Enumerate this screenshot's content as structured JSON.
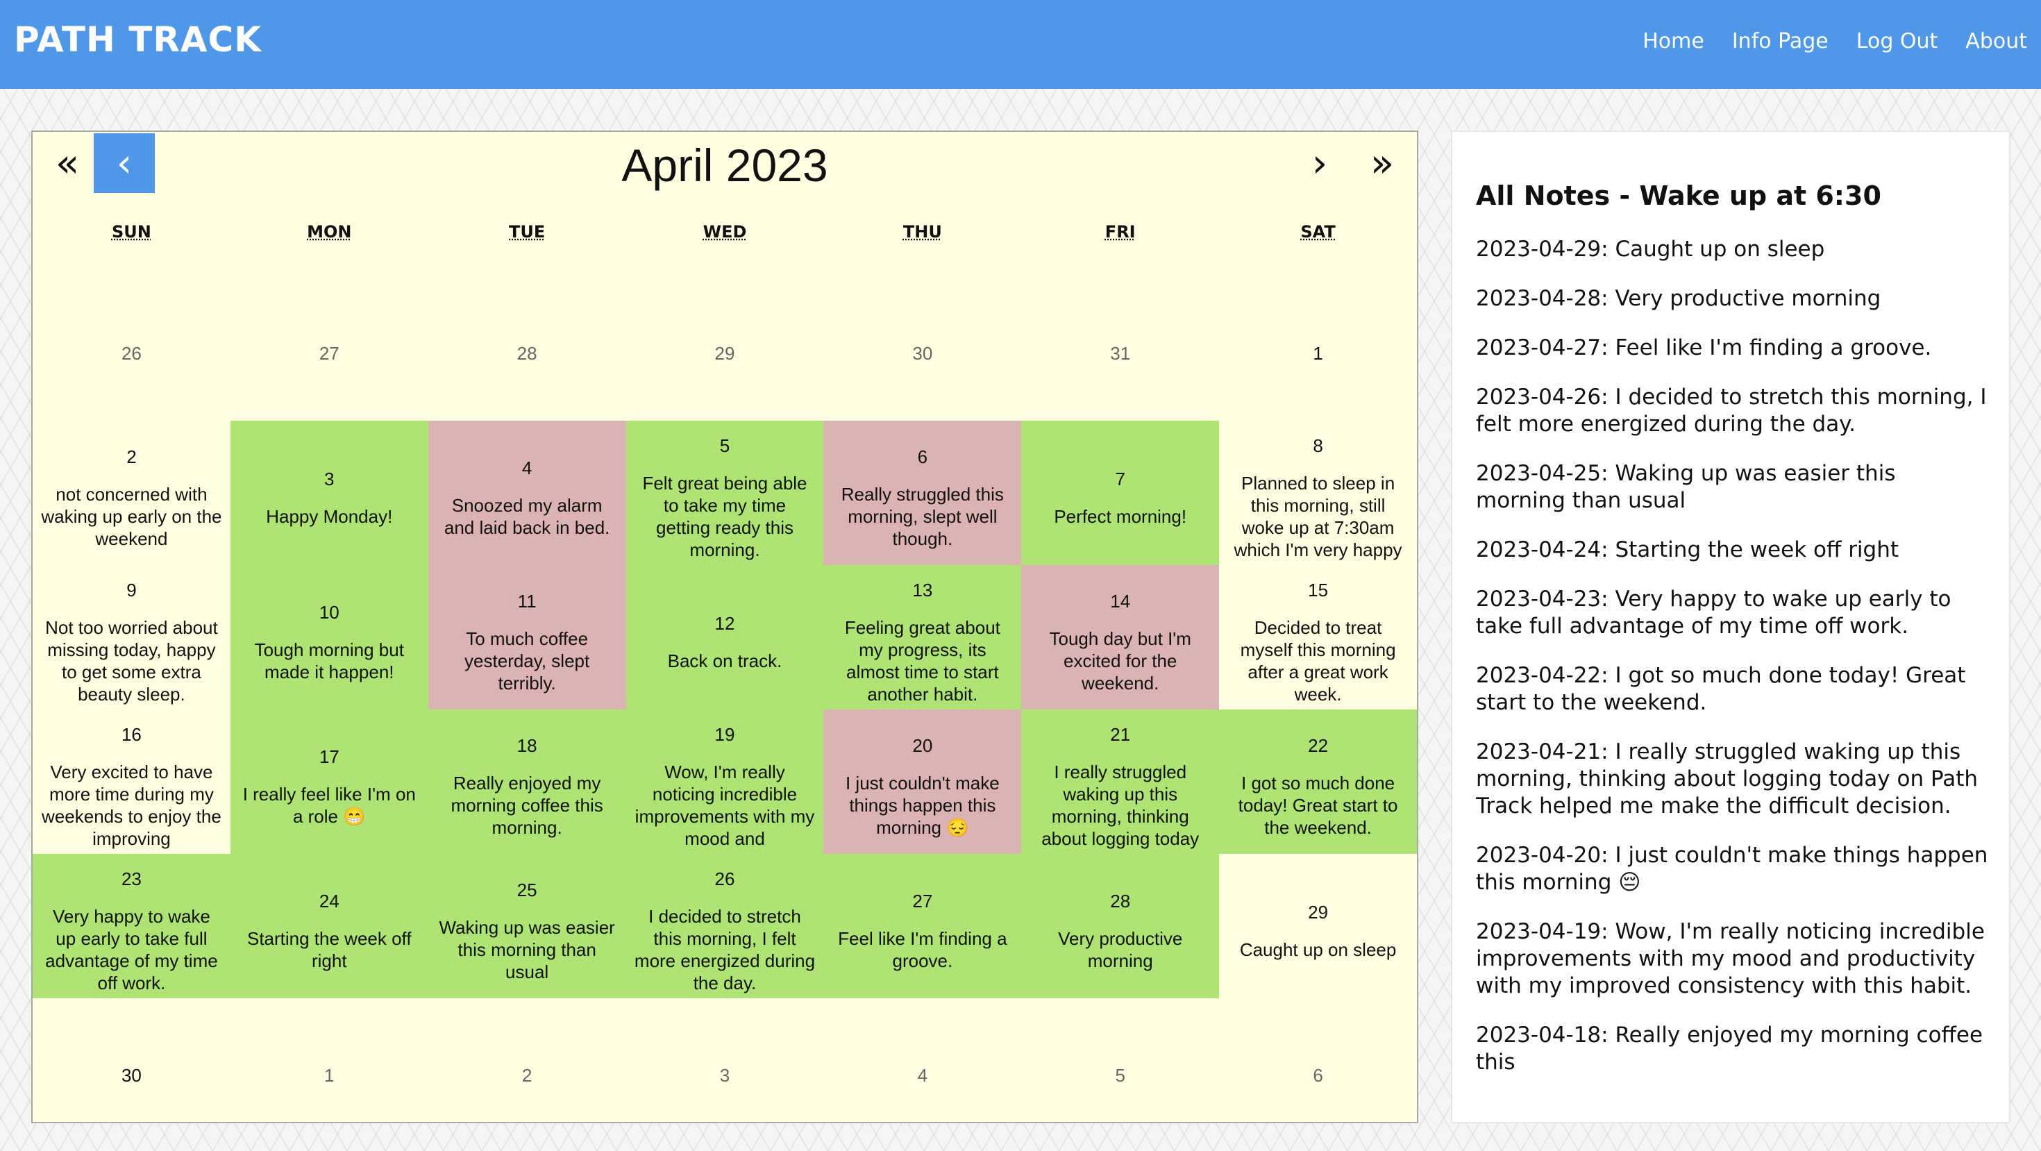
{
  "app": {
    "brand": "PATH TRACK",
    "nav": [
      "Home",
      "Info Page",
      "Log Out",
      "About"
    ]
  },
  "calendar": {
    "title": "April 2023",
    "controls": {
      "prev_year": "«",
      "prev_month": "‹",
      "next_month": "›",
      "next_year": "»"
    },
    "weekdays": [
      "SUN",
      "MON",
      "TUE",
      "WED",
      "THU",
      "FRI",
      "SAT"
    ],
    "colors": {
      "good": "#aee474",
      "bad": "#dbb3b3",
      "background": "#ffffe2",
      "accent": "#4e97e9"
    },
    "weeks": [
      [
        {
          "day": "26",
          "note": "",
          "status": "other"
        },
        {
          "day": "27",
          "note": "",
          "status": "other"
        },
        {
          "day": "28",
          "note": "",
          "status": "other"
        },
        {
          "day": "29",
          "note": "",
          "status": "other"
        },
        {
          "day": "30",
          "note": "",
          "status": "other"
        },
        {
          "day": "31",
          "note": "",
          "status": "other"
        },
        {
          "day": "1",
          "note": "",
          "status": "empty"
        }
      ],
      [
        {
          "day": "2",
          "note": "not concerned with waking up early on the weekend",
          "status": "none"
        },
        {
          "day": "3",
          "note": "Happy Monday!",
          "status": "good"
        },
        {
          "day": "4",
          "note": "Snoozed my alarm and laid back in bed.",
          "status": "bad"
        },
        {
          "day": "5",
          "note": "Felt great being able to take my time getting ready this morning.",
          "status": "good"
        },
        {
          "day": "6",
          "note": "Really struggled this morning, slept well though.",
          "status": "bad"
        },
        {
          "day": "7",
          "note": "Perfect morning!",
          "status": "good"
        },
        {
          "day": "8",
          "note": "Planned to sleep in this morning, still woke up at 7:30am which I'm very happy",
          "status": "none"
        }
      ],
      [
        {
          "day": "9",
          "note": "Not too worried about missing today, happy to get some extra beauty sleep.",
          "status": "none"
        },
        {
          "day": "10",
          "note": "Tough morning but made it happen!",
          "status": "good"
        },
        {
          "day": "11",
          "note": "To much coffee yesterday, slept terribly.",
          "status": "bad"
        },
        {
          "day": "12",
          "note": "Back on track.",
          "status": "good"
        },
        {
          "day": "13",
          "note": "Feeling great about my progress, its almost time to start another habit.",
          "status": "good"
        },
        {
          "day": "14",
          "note": "Tough day but I'm excited for the weekend.",
          "status": "bad"
        },
        {
          "day": "15",
          "note": "Decided to treat myself this morning after a great work week.",
          "status": "none"
        }
      ],
      [
        {
          "day": "16",
          "note": "Very excited to have more time during my weekends to enjoy the improving",
          "status": "none"
        },
        {
          "day": "17",
          "note": "I really feel like I'm on a role 😁",
          "status": "good"
        },
        {
          "day": "18",
          "note": "Really enjoyed my morning coffee this morning.",
          "status": "good"
        },
        {
          "day": "19",
          "note": "Wow, I'm really noticing incredible improvements with my mood and",
          "status": "good"
        },
        {
          "day": "20",
          "note": "I just couldn't make things happen this morning 😔",
          "status": "bad"
        },
        {
          "day": "21",
          "note": "I really struggled waking up this morning, thinking about logging today",
          "status": "good"
        },
        {
          "day": "22",
          "note": "I got so much done today! Great start to the weekend.",
          "status": "good"
        }
      ],
      [
        {
          "day": "23",
          "note": "Very happy to wake up early to take full advantage of my time off work.",
          "status": "good"
        },
        {
          "day": "24",
          "note": "Starting the week off right",
          "status": "good"
        },
        {
          "day": "25",
          "note": "Waking up was easier this morning than usual",
          "status": "good"
        },
        {
          "day": "26",
          "note": "I decided to stretch this morning, I felt more energized during the day.",
          "status": "good"
        },
        {
          "day": "27",
          "note": "Feel like I'm finding a groove.",
          "status": "good"
        },
        {
          "day": "28",
          "note": "Very productive morning",
          "status": "good"
        },
        {
          "day": "29",
          "note": "Caught up on sleep",
          "status": "none"
        }
      ],
      [
        {
          "day": "30",
          "note": "",
          "status": "empty"
        },
        {
          "day": "1",
          "note": "",
          "status": "other"
        },
        {
          "day": "2",
          "note": "",
          "status": "other"
        },
        {
          "day": "3",
          "note": "",
          "status": "other"
        },
        {
          "day": "4",
          "note": "",
          "status": "other"
        },
        {
          "day": "5",
          "note": "",
          "status": "other"
        },
        {
          "day": "6",
          "note": "",
          "status": "other"
        }
      ]
    ]
  },
  "notes": {
    "title": "All Notes - Wake up at 6:30",
    "items": [
      "2023-04-29: Caught up on sleep",
      "2023-04-28: Very productive morning",
      "2023-04-27: Feel like I'm finding a groove.",
      "2023-04-26: I decided to stretch this morning, I felt more energized during the day.",
      "2023-04-25: Waking up was easier this morning than usual",
      "2023-04-24: Starting the week off right",
      "2023-04-23: Very happy to wake up early to take full advantage of my time off work.",
      "2023-04-22: I got so much done today! Great start to the weekend.",
      "2023-04-21: I really struggled waking up this morning, thinking about logging today on Path Track helped me make the difficult decision.",
      "2023-04-20: I just couldn't make things happen this morning 😔",
      "2023-04-19: Wow, I'm really noticing incredible improvements with my mood and productivity with my improved consistency with this habit.",
      "2023-04-18: Really enjoyed my morning coffee this"
    ]
  }
}
